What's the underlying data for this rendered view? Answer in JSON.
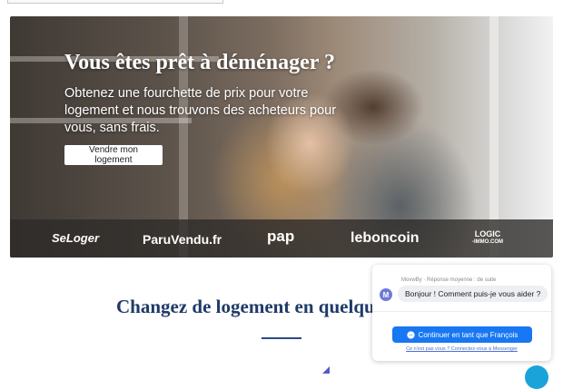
{
  "hero": {
    "title": "Vous êtes prêt à déménager ?",
    "subtitle": "Obtenez une fourchette de prix pour votre logement et nous trouvons des acheteurs pour vous, sans frais.",
    "cta_label": "Vendre mon logement"
  },
  "partners": {
    "seloger": "SeLoger",
    "paruvendu": "ParuVendu.fr",
    "pap": "pap",
    "leboncoin": "leboncoin",
    "logic_top": "LOGIC",
    "logic_bottom": "-IMMO.COM"
  },
  "section": {
    "heading": "Changez de logement en quelqu"
  },
  "chat": {
    "meta": "MovwBy · Réponse moyenne : de suite",
    "avatar_letter": "M",
    "message": "Bonjour ! Comment puis-je vous aider ?",
    "button_label": "Continuer en tant que François",
    "not_you": "Ce n'est pas vous ? Connectez-vous à Messenger"
  },
  "colors": {
    "heading": "#1f3a68",
    "messenger_blue": "#1877f2",
    "launcher": "#1aa3d9"
  },
  "icons": {
    "avatar": "widget-avatar-icon",
    "messenger": "messenger-icon",
    "launcher": "chat-launcher-icon"
  }
}
